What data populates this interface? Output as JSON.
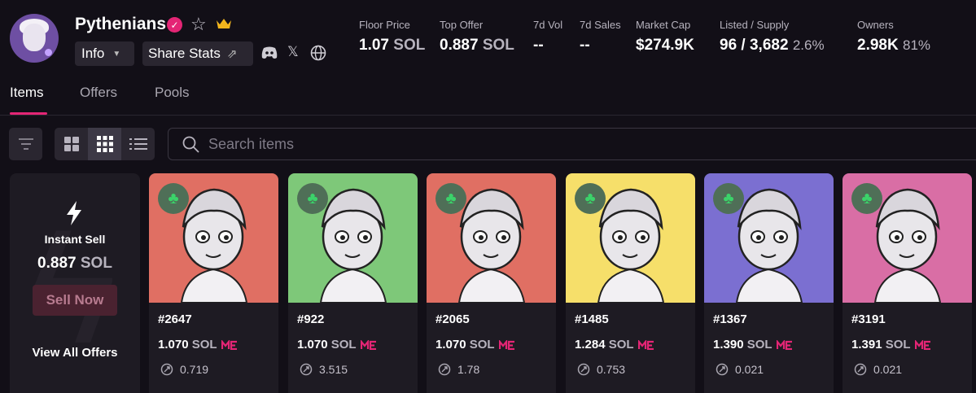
{
  "collection": {
    "name": "Pythenians",
    "info_label": "Info",
    "share_label": "Share Stats"
  },
  "stats": [
    {
      "label": "Floor Price",
      "value": "1.07",
      "unit": "SOL",
      "extra": ""
    },
    {
      "label": "Top Offer",
      "value": "0.887",
      "unit": "SOL",
      "extra": ""
    },
    {
      "label": "7d Vol",
      "value": "--",
      "unit": "",
      "extra": ""
    },
    {
      "label": "7d Sales",
      "value": "--",
      "unit": "",
      "extra": ""
    },
    {
      "label": "Market Cap",
      "value": "$274.9K",
      "unit": "",
      "extra": ""
    },
    {
      "label": "Listed / Supply",
      "value": "96 / 3,682",
      "unit": "",
      "extra": "2.6%"
    },
    {
      "label": "Owners",
      "value": "2.98K",
      "unit": "",
      "extra": "81%"
    }
  ],
  "tabs": [
    "Items",
    "Offers",
    "Pools"
  ],
  "active_tab": "Items",
  "search": {
    "placeholder": "Search items"
  },
  "instant_sell": {
    "title": "Instant Sell",
    "price": "0.887",
    "unit": "SOL",
    "sell_label": "Sell Now",
    "view_offers_label": "View All Offers"
  },
  "items": [
    {
      "name": "#2647",
      "price": "1.070",
      "unit": "SOL",
      "rank": "0.719",
      "bg": "#e06f63"
    },
    {
      "name": "#922",
      "price": "1.070",
      "unit": "SOL",
      "rank": "3.515",
      "bg": "#7ec879"
    },
    {
      "name": "#2065",
      "price": "1.070",
      "unit": "SOL",
      "rank": "1.78",
      "bg": "#e06f63"
    },
    {
      "name": "#1485",
      "price": "1.284",
      "unit": "SOL",
      "rank": "0.753",
      "bg": "#f6df6a"
    },
    {
      "name": "#1367",
      "price": "1.390",
      "unit": "SOL",
      "rank": "0.021",
      "bg": "#7b6fd1"
    },
    {
      "name": "#3191",
      "price": "1.391",
      "unit": "SOL",
      "rank": "0.021",
      "bg": "#d96ea5"
    }
  ],
  "colors": {
    "accent": "#e42575",
    "background": "#120f17",
    "card": "#1e1b23"
  },
  "icons": {
    "verified": "verified-badge-icon",
    "star": "star-icon",
    "crown": "crown-icon",
    "clover": "clover-icon"
  }
}
